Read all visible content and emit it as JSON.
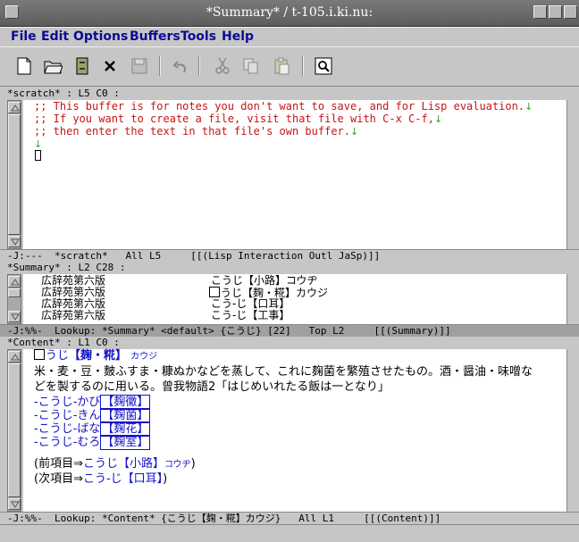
{
  "window": {
    "title": "*Summary* / t-105.i.ki.nu:"
  },
  "menubar": {
    "items": [
      "File",
      "Edit",
      "Options",
      "Buffers",
      "Tools",
      "Help"
    ]
  },
  "toolbar": {
    "icons": [
      "new-file-icon",
      "open-folder-icon",
      "dired-icon",
      "close-x-icon",
      "save-icon",
      "undo-icon",
      "cut-icon",
      "copy-icon",
      "paste-icon",
      "search-icon"
    ]
  },
  "scratch": {
    "header": "*scratch* : L5 C0 :",
    "lines": [
      ";; This buffer is for notes you don't want to save, and for Lisp evaluation.",
      ";; If you want to create a file, visit that file with C-x C-f,",
      ";; then enter the text in that file's own buffer."
    ],
    "modeline": "-J:---  *scratch*   All L5     [[(Lisp Interaction Outl JaSp)]]"
  },
  "summary": {
    "header": "*Summary* : L2 C28 :",
    "rows": [
      {
        "dict": "広辞苑第六版",
        "entry": "こうじ【小路】コウヂ"
      },
      {
        "dict": "広辞苑第六版",
        "entry": "うじ【麹・糀】カウジ"
      },
      {
        "dict": "広辞苑第六版",
        "entry": "こう-じ【口耳】"
      },
      {
        "dict": "広辞苑第六版",
        "entry": "こう-じ【工事】"
      }
    ],
    "modeline": "-J:%%-  Lookup: *Summary* <default> {こうじ} [22]   Top L2     [[(Summary)]]"
  },
  "content": {
    "header": "*Content* : L1 C0 :",
    "headword": "うじ",
    "headword_kanji": "【麹・糀】",
    "headword_reading": "カウジ",
    "body1": "米・麦・豆・麬ふすま・糠ぬかなどを蒸して、これに麹菌を繁殖させたもの。酒・醤油・味噌な",
    "body2": "どを製するのに用いる。曾我物語2「はじめいれたる飯は一となり」",
    "links": [
      {
        "prefix": "-こうじ-かび",
        "kanji": "【麹黴】"
      },
      {
        "prefix": "-こうじ-きん",
        "kanji": "【麹菌】"
      },
      {
        "prefix": "-こうじ-ばな",
        "kanji": "【麹花】"
      },
      {
        "prefix": "-こうじ-むろ",
        "kanji": "【麹室】"
      }
    ],
    "prev_label": "(前項目⇒",
    "prev_link": "こうじ【小路】",
    "prev_reading": "コウヂ",
    "prev_close": ")",
    "next_label": "(次項目⇒",
    "next_link": "こう-じ【口耳】",
    "next_close": ")",
    "modeline": "-J:%%-  Lookup: *Content* {こうじ【麹・糀】カウジ}   All L1     [[(Content)]]"
  }
}
